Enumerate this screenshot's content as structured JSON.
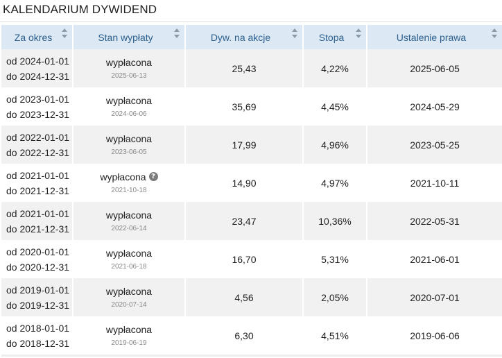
{
  "page_title": "KALENDARIUM DYWIDEND",
  "icons": {
    "sort": "sort-icon",
    "help": "help-icon"
  },
  "colors": {
    "header_bg": "#dce8f3",
    "header_text": "#2a5f8f",
    "row_alt_bg": "#f1f1f1"
  },
  "table": {
    "columns": [
      "Za okres",
      "Stan wypłaty",
      "Dyw. na akcje",
      "Stopa",
      "Ustalenie prawa"
    ],
    "rows": [
      {
        "from": "od 2024-01-01",
        "to": "do 2024-12-31",
        "status": "wypłacona",
        "paid_date": "2025-06-13",
        "dividend": "25,43",
        "yield": "4,22%",
        "record_date": "2025-06-05",
        "help": false
      },
      {
        "from": "od 2023-01-01",
        "to": "do 2023-12-31",
        "status": "wypłacona",
        "paid_date": "2024-06-06",
        "dividend": "35,69",
        "yield": "4,45%",
        "record_date": "2024-05-29",
        "help": false
      },
      {
        "from": "od 2022-01-01",
        "to": "do 2022-12-31",
        "status": "wypłacona",
        "paid_date": "2023-06-05",
        "dividend": "17,99",
        "yield": "4,96%",
        "record_date": "2023-05-25",
        "help": false
      },
      {
        "from": "od 2021-01-01",
        "to": "do 2021-12-31",
        "status": "wypłacona",
        "paid_date": "2021-10-18",
        "dividend": "14,90",
        "yield": "4,97%",
        "record_date": "2021-10-11",
        "help": true
      },
      {
        "from": "od 2021-01-01",
        "to": "do 2021-12-31",
        "status": "wypłacona",
        "paid_date": "2022-06-14",
        "dividend": "23,47",
        "yield": "10,36%",
        "record_date": "2022-05-31",
        "help": false
      },
      {
        "from": "od 2020-01-01",
        "to": "do 2020-12-31",
        "status": "wypłacona",
        "paid_date": "2021-06-18",
        "dividend": "16,70",
        "yield": "5,31%",
        "record_date": "2021-06-01",
        "help": false
      },
      {
        "from": "od 2019-01-01",
        "to": "do 2019-12-31",
        "status": "wypłacona",
        "paid_date": "2020-07-14",
        "dividend": "4,56",
        "yield": "2,05%",
        "record_date": "2020-07-01",
        "help": false
      },
      {
        "from": "od 2018-01-01",
        "to": "do 2018-12-31",
        "status": "wypłacona",
        "paid_date": "2019-06-19",
        "dividend": "6,30",
        "yield": "4,51%",
        "record_date": "2019-06-06",
        "help": false
      }
    ]
  }
}
